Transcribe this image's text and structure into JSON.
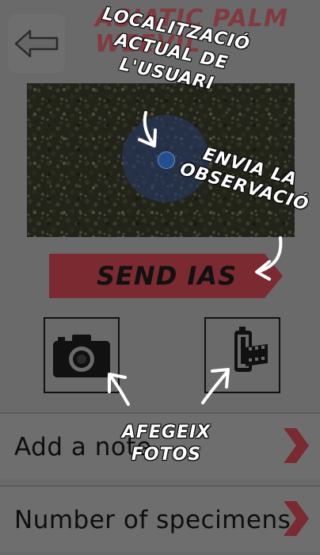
{
  "header": {
    "title": "ASIATIC PALM WEEVIL"
  },
  "map": {
    "location_label": "user-location"
  },
  "send_button": {
    "label": "SEND IAS",
    "color": "#8a2a32"
  },
  "photos": {
    "camera_icon": "camera-icon",
    "gallery_icon": "film-roll-icon"
  },
  "rows": [
    {
      "label": "Add a note"
    },
    {
      "label": "Number of specimens"
    }
  ],
  "annotations": {
    "location": "LOCALITZACIÓ ACTUAL DE L'USUARI",
    "send": "ENVIA LA OBSERVACIÓ",
    "photos": "AFEGEIX FOTOS"
  },
  "colors": {
    "accent": "#8a2a32",
    "row_chevron": "#8a2a32"
  }
}
